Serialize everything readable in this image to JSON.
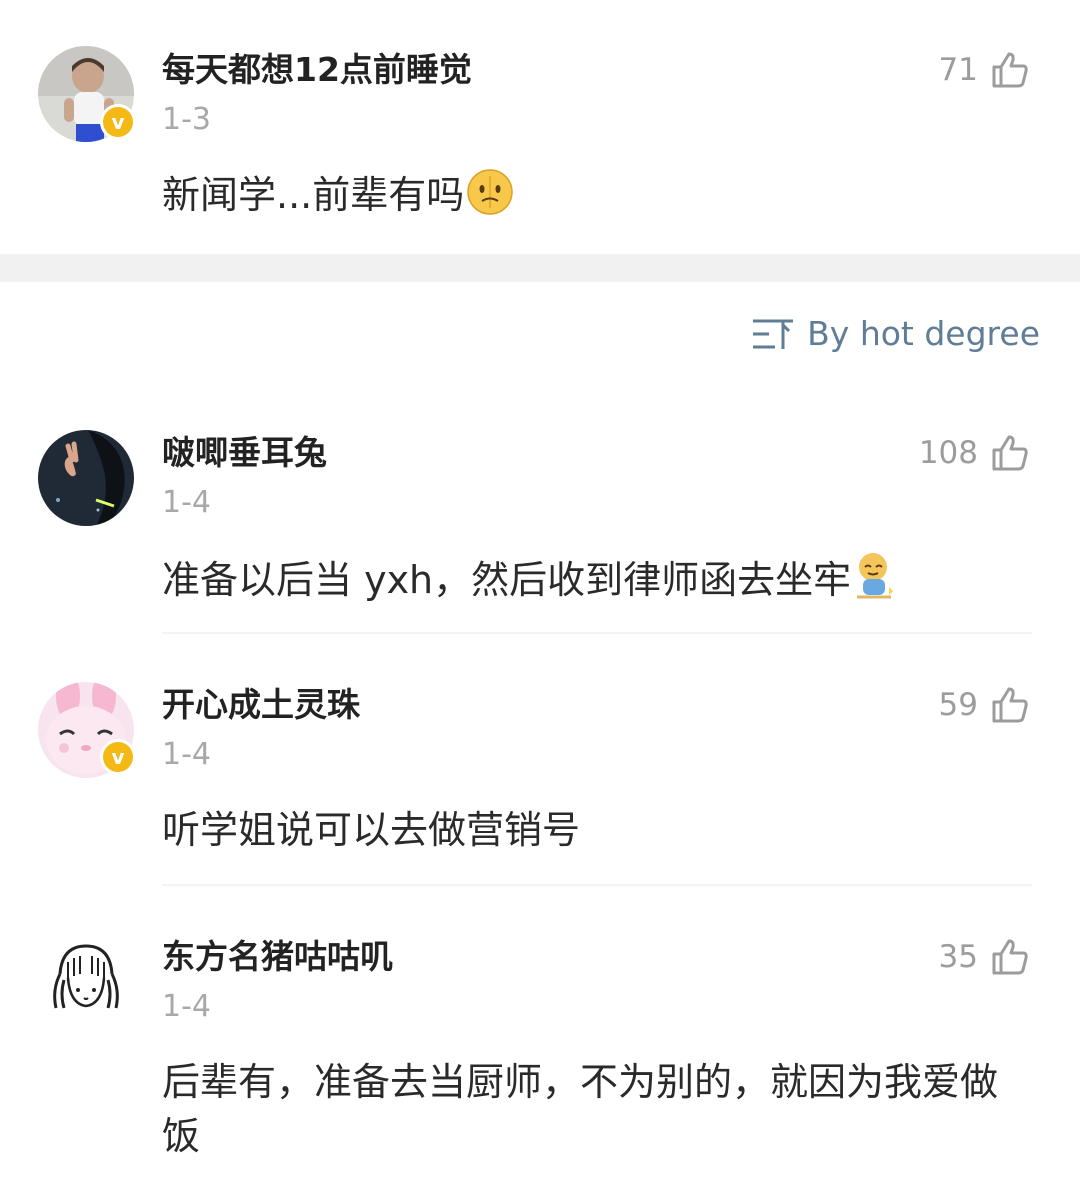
{
  "top_comment": {
    "username": "每天都想12点前睡觉",
    "date": "1-3",
    "likes": "71",
    "text": "新闻学...前辈有吗",
    "emoji": "thinking-face-emoji",
    "verified": true
  },
  "sort": {
    "label": "By hot degree",
    "icon": "sort-lines-icon"
  },
  "comments": [
    {
      "username": "啵唧垂耳兔",
      "date": "1-4",
      "likes": "108",
      "text": "准备以后当 yxh，然后收到律师函去坐牢",
      "emoji": "sitting-doge-emoji",
      "verified": false
    },
    {
      "username": "开心成土灵珠",
      "date": "1-4",
      "likes": "59",
      "text": "听学姐说可以去做营销号",
      "verified": true
    },
    {
      "username": "东方名猪咕咕叽",
      "date": "1-4",
      "likes": "35",
      "text": "后辈有，准备去当厨师，不为别的，就因为我爱做饭",
      "verified": false
    }
  ],
  "colors": {
    "username": "#222222",
    "muted": "#a8a8a8",
    "accent_link": "#5f7d96",
    "badge": "#f5b915",
    "separator": "#f1f1f1"
  }
}
